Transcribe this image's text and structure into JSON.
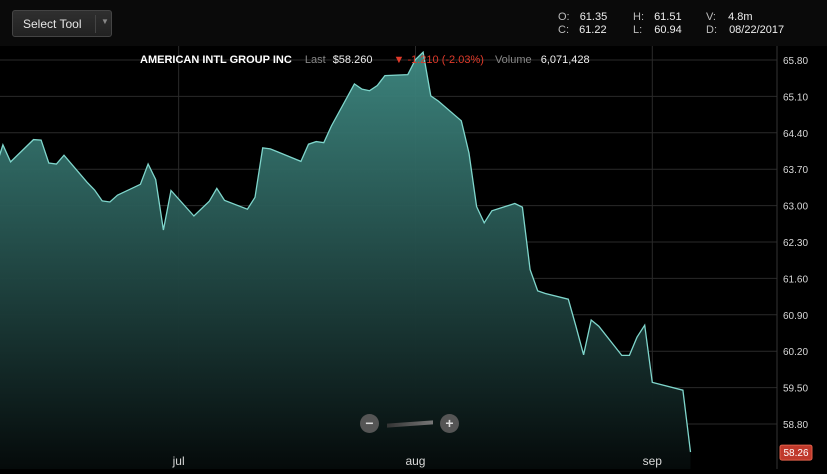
{
  "toolbar": {
    "select_tool_label": "Select Tool"
  },
  "ohlc": {
    "open_label": "O:",
    "open": "61.35",
    "close_label": "C:",
    "close": "61.22",
    "high_label": "H:",
    "high": "61.51",
    "low_label": "L:",
    "low": "60.94",
    "volume_label": "V:",
    "volume": "4.8m",
    "date_label": "D:",
    "date": "08/22/2017"
  },
  "info": {
    "symbol": "AMERICAN INTL GROUP INC",
    "last_label": "Last",
    "last": "$58.260",
    "change": "▼ -1.210 (-2.03%)",
    "volume_label": "Volume",
    "volume": "6,071,428"
  },
  "zoom": {
    "minus": "−",
    "plus": "+"
  },
  "colors": {
    "line": "#7fd6cc",
    "fill_top": "#3f8a83",
    "fill_bottom": "#050a0a",
    "down": "#e03a2a",
    "grid": "#2a2a2a"
  },
  "chart_data": {
    "type": "area",
    "ylim": [
      58.26,
      65.95
    ],
    "y_ticks": [
      "65.80",
      "65.10",
      "64.40",
      "63.70",
      "63.00",
      "62.30",
      "61.60",
      "60.90",
      "60.20",
      "59.50",
      "58.80"
    ],
    "x_ticks": [
      "jul",
      "aug",
      "sep"
    ],
    "last_value_label": "58.26",
    "values": [
      63.12,
      63.42,
      63.71,
      64.17,
      63.84,
      64.27,
      64.26,
      63.82,
      63.8,
      63.97,
      63.45,
      63.3,
      63.09,
      63.07,
      63.2,
      63.41,
      63.8,
      63.5,
      62.53,
      63.29,
      62.8,
      63.08,
      63.33,
      63.1,
      62.93,
      63.16,
      64.11,
      64.09,
      64.03,
      63.85,
      64.18,
      64.23,
      64.21,
      64.53,
      65.34,
      65.24,
      65.21,
      65.31,
      65.5,
      65.52,
      65.81,
      65.95,
      65.11,
      65.01,
      64.63,
      64.01,
      62.98,
      62.67,
      62.9,
      63.04,
      62.97,
      61.77,
      61.36,
      61.31,
      61.2,
      60.68,
      60.13,
      60.8,
      60.68,
      60.12,
      60.12,
      60.47,
      60.7,
      59.6,
      59.45,
      58.26
    ],
    "x_dates": [
      "2017-06-05",
      "2017-06-06",
      "2017-06-07",
      "2017-06-08",
      "2017-06-09",
      "2017-06-12",
      "2017-06-13",
      "2017-06-14",
      "2017-06-15",
      "2017-06-16",
      "2017-06-19",
      "2017-06-20",
      "2017-06-21",
      "2017-06-22",
      "2017-06-23",
      "2017-06-26",
      "2017-06-27",
      "2017-06-28",
      "2017-06-29",
      "2017-06-30",
      "2017-07-03",
      "2017-07-05",
      "2017-07-06",
      "2017-07-07",
      "2017-07-10",
      "2017-07-11",
      "2017-07-12",
      "2017-07-13",
      "2017-07-14",
      "2017-07-17",
      "2017-07-18",
      "2017-07-19",
      "2017-07-20",
      "2017-07-21",
      "2017-07-24",
      "2017-07-25",
      "2017-07-26",
      "2017-07-27",
      "2017-07-28",
      "2017-07-31",
      "2017-08-01",
      "2017-08-02",
      "2017-08-03",
      "2017-08-04",
      "2017-08-07",
      "2017-08-08",
      "2017-08-09",
      "2017-08-10",
      "2017-08-11",
      "2017-08-14",
      "2017-08-15",
      "2017-08-16",
      "2017-08-17",
      "2017-08-18",
      "2017-08-21",
      "2017-08-22",
      "2017-08-23",
      "2017-08-24",
      "2017-08-25",
      "2017-08-28",
      "2017-08-29",
      "2017-08-30",
      "2017-08-31",
      "2017-09-01",
      "2017-09-05",
      "2017-09-06"
    ],
    "grid": true
  }
}
